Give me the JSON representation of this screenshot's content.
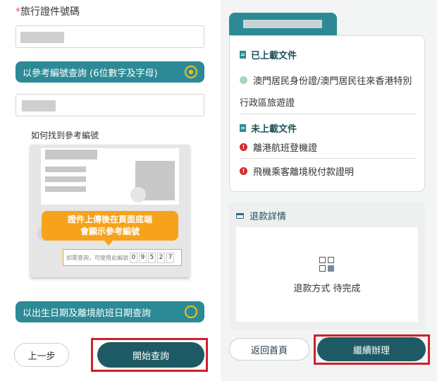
{
  "left": {
    "field_label_required": "*",
    "field_label": "旅行證件號碼",
    "option_reference": "以參考編號查詢 (6位數字及字母)",
    "help_link": "如何找到參考編號",
    "tooltip_line1": "證件上傳後在頁面底端",
    "tooltip_line2": "會顯示參考編號",
    "ref_hint": "如需查詢，可使用此編號",
    "ref_digits": [
      "0",
      "9",
      "5",
      "2",
      "7"
    ],
    "option_dob": "以出生日期及離境航班日期查詢",
    "back_button": "上一步",
    "start_button": "開始查詢"
  },
  "right": {
    "uploaded_title": "已上載文件",
    "uploaded_item_line1": "澳門居民身份證/澳門居民往來香港特別",
    "uploaded_item_line2": "行政區旅遊證",
    "not_uploaded_title": "未上載文件",
    "missing_items": [
      "離港航班登機證",
      "飛機乘客離境稅付款證明"
    ],
    "refund_title": "退款詳情",
    "refund_status": "退款方式 待完成",
    "home_button": "返回首頁",
    "continue_button": "繼續辦理"
  },
  "colors": {
    "teal": "#2c8a96",
    "dark_teal": "#1e5a63",
    "highlight_red": "#d0202e",
    "tooltip_orange": "#f7a21b",
    "radio_yellow": "#f2c31b"
  },
  "icons": [
    "radio-selected",
    "radio-unselected",
    "document-icon",
    "check-circle-icon",
    "exclamation-circle-icon",
    "card-icon",
    "grid-check-icon"
  ]
}
